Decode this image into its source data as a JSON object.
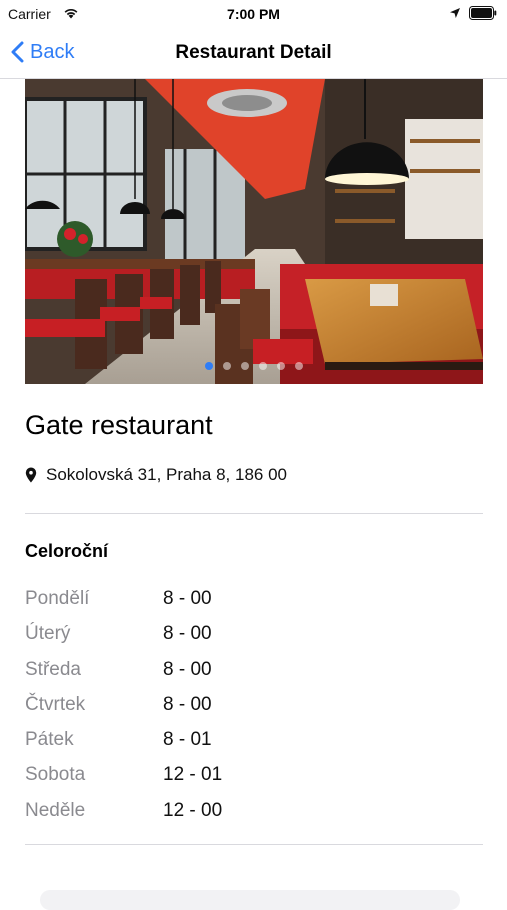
{
  "status_bar": {
    "carrier": "Carrier",
    "time": "7:00 PM"
  },
  "nav": {
    "back_label": "Back",
    "title": "Restaurant Detail"
  },
  "carousel": {
    "page_count": 6,
    "current_page": 1
  },
  "restaurant": {
    "name": "Gate restaurant",
    "address": "Sokolovská 31, Praha 8, 186 00"
  },
  "hours": {
    "season": "Celoroční",
    "days": [
      {
        "day": "Pondělí",
        "value": "8 - 00"
      },
      {
        "day": "Úterý",
        "value": "8 - 00"
      },
      {
        "day": "Středa",
        "value": "8 - 00"
      },
      {
        "day": "Čtvrtek",
        "value": "8 - 00"
      },
      {
        "day": "Pátek",
        "value": "8 - 01"
      },
      {
        "day": "Sobota",
        "value": "12 - 01"
      },
      {
        "day": "Neděle",
        "value": "12 - 00"
      }
    ]
  },
  "colors": {
    "accent": "#2f7df6",
    "secondary_text": "#8a8a8f",
    "divider": "#d9d9de"
  }
}
